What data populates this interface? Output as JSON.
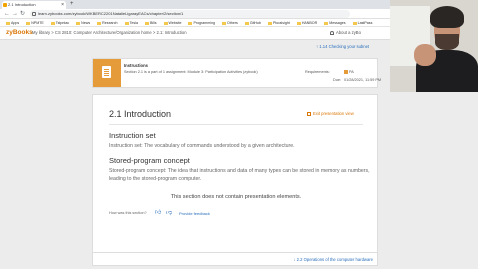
{
  "browser": {
    "tab_title": "2.1 Introduction",
    "url": "learn.zybooks.com/zybook/WKBERC2201NatalieLigarayEACs/chapter/2/section/1",
    "bookmarks": [
      "Apps",
      "NPMTE",
      "Tstpntac",
      "News",
      "Research",
      "Tesla",
      "Bills",
      "Website",
      "Programming",
      "Others",
      "GitHub",
      "Pluralsight",
      "HANBOR",
      "Messages",
      "LastPass"
    ]
  },
  "zybooks": {
    "logo": "zyBooks",
    "breadcrumb": "My library > CS 2810: Computer Architecture/Organization home > 2.1: Introduction",
    "about": "About a zyBo"
  },
  "nav": {
    "prev": "↑ 1.14 Checking your subnet",
    "next": "↓ 2.2 Operations of the computer hardware"
  },
  "instructions": {
    "title": "Instructions",
    "text": "Section 2.1 is a part of 1 assignment: Module 3: Participation Activities (zybook)",
    "requirements_label": "Requirements:",
    "requirements_value": "PA",
    "due_label": "Due:",
    "due_value": "01/28/2021, 11:59 PM"
  },
  "section": {
    "title": "2.1 Introduction",
    "exit_presentation": "Exit presentation view",
    "h_instruction_set": "Instruction set",
    "p_instruction_set": "Instruction set: The vocabulary of commands understood by a given architecture.",
    "h_stored_program": "Stored-program concept",
    "p_stored_program": "Stored-program concept: The idea that instructions and data of many types can be stored in memory as numbers, leading to the stored-program computer.",
    "no_presentation": "This section does not contain presentation elements.",
    "how_was": "How was this section?",
    "feedback": "Provide feedback"
  },
  "colors": {
    "accent": "#d97706",
    "link": "#2a6ebb",
    "instr_icon_bg": "#e69b3a"
  }
}
